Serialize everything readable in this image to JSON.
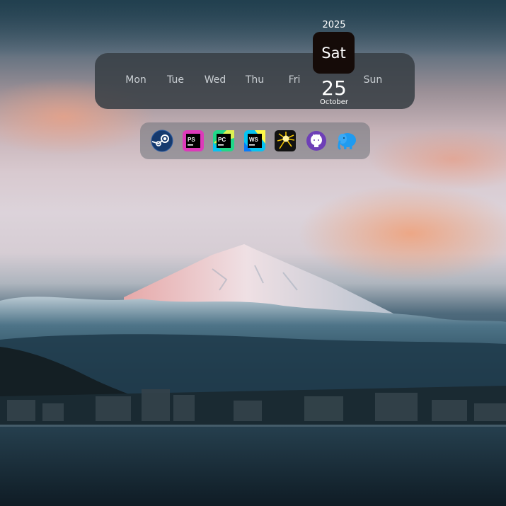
{
  "calendar": {
    "weekdays": [
      "Mon",
      "Tue",
      "Wed",
      "Thu",
      "Fri",
      "Sat",
      "Sun"
    ],
    "today": {
      "weekday": "Sat",
      "day": "25",
      "month": "October",
      "year": "2025"
    }
  },
  "dock": {
    "apps": [
      {
        "icon": "steam-icon",
        "glyph": ""
      },
      {
        "icon": "phpstorm-icon",
        "glyph": "PS"
      },
      {
        "icon": "pycharm-icon",
        "glyph": "PC"
      },
      {
        "icon": "webstorm-icon",
        "glyph": "WS"
      },
      {
        "icon": "sun-burst-app-icon",
        "glyph": ""
      },
      {
        "icon": "github-icon",
        "glyph": ""
      },
      {
        "icon": "elephant-app-icon",
        "glyph": ""
      }
    ]
  },
  "colors": {
    "today_card": "#150b08",
    "week_bar": "#373e44",
    "dock_bg": "#6e737a"
  }
}
